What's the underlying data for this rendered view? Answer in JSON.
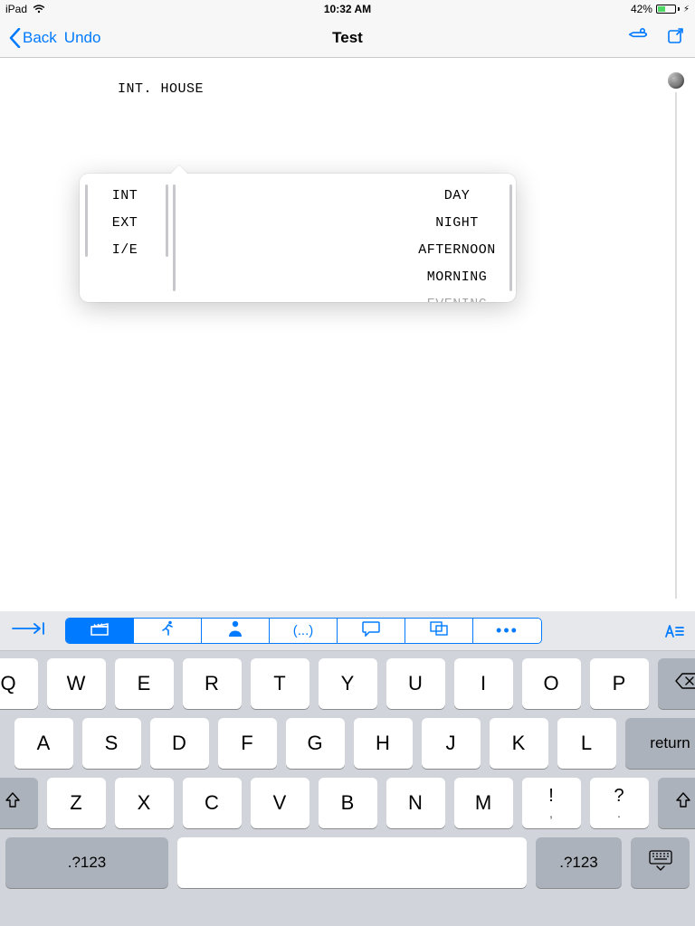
{
  "status": {
    "device": "iPad",
    "time": "10:32 AM",
    "battery_pct": "42%"
  },
  "nav": {
    "back": "Back",
    "undo": "Undo",
    "title": "Test"
  },
  "editor": {
    "scene_heading": "INT. HOUSE"
  },
  "popover": {
    "left": [
      "INT",
      "EXT",
      "I/E"
    ],
    "right": [
      "DAY",
      "NIGHT",
      "AFTERNOON",
      "MORNING",
      "EVENING"
    ]
  },
  "format_segments": {
    "items": [
      "scene-heading",
      "action",
      "character",
      "parenthetical",
      "dialogue",
      "transition",
      "more"
    ]
  },
  "keyboard": {
    "row1": [
      "Q",
      "W",
      "E",
      "R",
      "T",
      "Y",
      "U",
      "I",
      "O",
      "P"
    ],
    "row2": [
      "A",
      "S",
      "D",
      "F",
      "G",
      "H",
      "J",
      "K",
      "L"
    ],
    "row3": [
      "Z",
      "X",
      "C",
      "V",
      "B",
      "N",
      "M"
    ],
    "punct1_top": "!",
    "punct1_bot": ",",
    "punct2_top": "?",
    "punct2_bot": ".",
    "return": "return",
    "numsym": ".?123"
  }
}
